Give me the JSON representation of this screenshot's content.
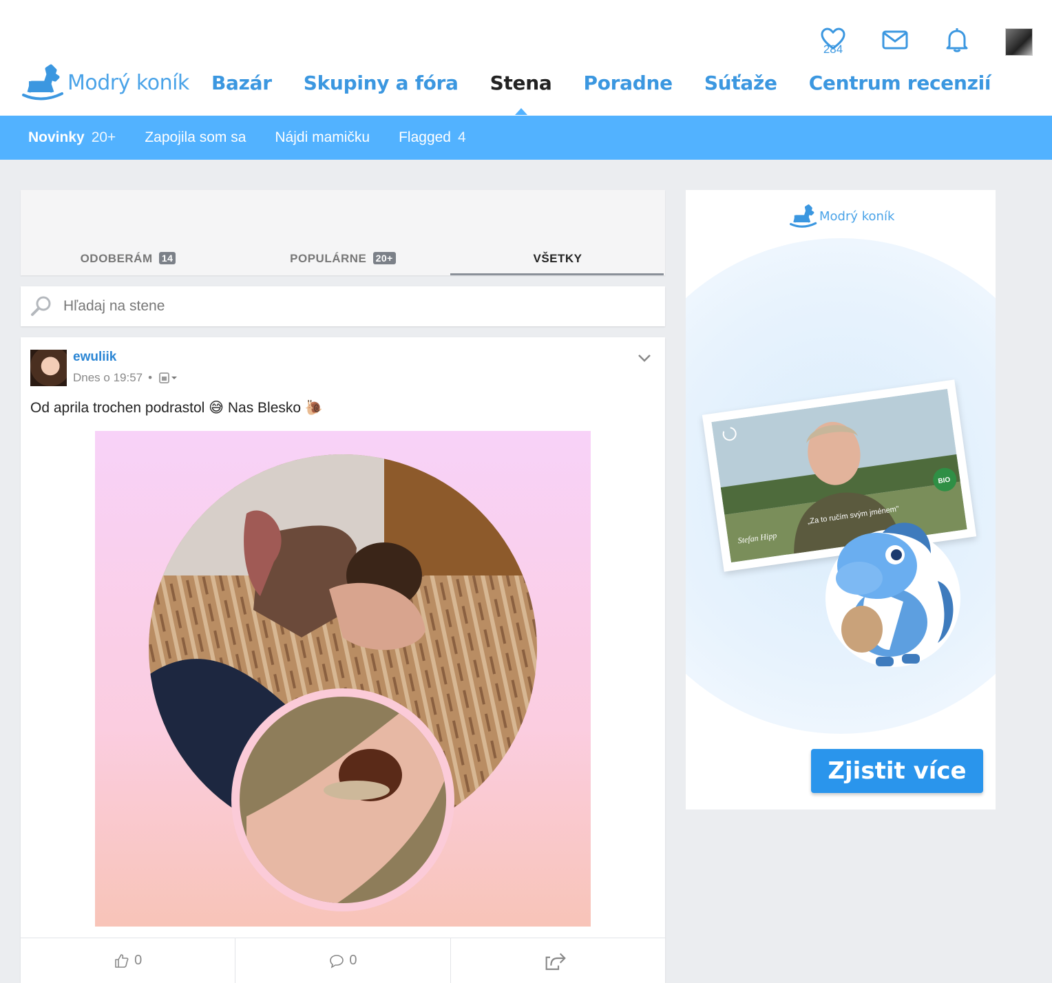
{
  "header": {
    "logo_text": "Modrý koník",
    "nav": [
      "Bazár",
      "Skupiny a fóra",
      "Stena",
      "Poradne",
      "Súťaže",
      "Centrum recenzií"
    ],
    "active_nav": "Stena",
    "heart_count": "284",
    "icons": [
      "heart-icon",
      "mail-icon",
      "bell-icon",
      "avatar"
    ]
  },
  "subnav": {
    "items": [
      {
        "label": "Novinky",
        "count": "20+"
      },
      {
        "label": "Zapojila som sa",
        "count": ""
      },
      {
        "label": "Nájdi mamičku",
        "count": ""
      },
      {
        "label": "Flagged",
        "count": "4"
      }
    ]
  },
  "feed_tabs": [
    {
      "label": "ODOBERÁM",
      "badge": "14"
    },
    {
      "label": "POPULÁRNE",
      "badge": "20+"
    },
    {
      "label": "VŠETKY",
      "badge": ""
    }
  ],
  "search": {
    "placeholder": "Hľadaj na stene"
  },
  "post": {
    "author": "ewuliik",
    "time": "Dnes o 19:57",
    "text": "Od aprila trochen podrastol 😅 Nas Blesko 🐌",
    "likes": "0",
    "comments": "0"
  },
  "ad": {
    "logo_text": "Modrý koník",
    "quote": "„Za to ručím svým jménem\"",
    "signature": "Stefan Hipp",
    "bio_badge": "BIO",
    "cta": "Zjistit více"
  },
  "colors": {
    "brand_blue": "#3b97e0",
    "subnav_blue": "#52b2ff",
    "cta_blue": "#2a95ec"
  }
}
